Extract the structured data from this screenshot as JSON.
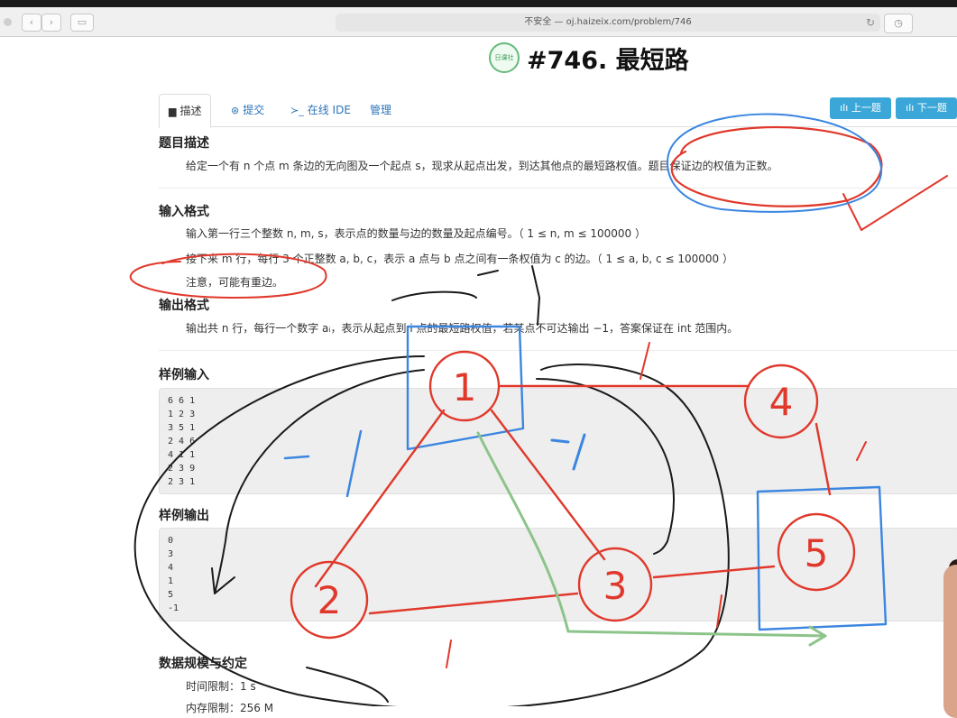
{
  "browser": {
    "url": "不安全 — oj.haizeix.com/problem/746",
    "back_icon": "‹",
    "forward_icon": "›",
    "sidebar_icon": "▭",
    "reload_icon": "↻",
    "history_icon": "◷"
  },
  "logo_text": "日课社",
  "problem_title": "#746. 最短路",
  "tabs": [
    {
      "label": "描述",
      "icon": "▆"
    },
    {
      "label": "提交",
      "icon": "⊛"
    },
    {
      "label": "在线 IDE",
      "icon": "≻_"
    },
    {
      "label": "管理",
      "icon": ""
    }
  ],
  "nav_buttons": {
    "prev": "上一题",
    "next": "下一题",
    "icon": "ılı"
  },
  "sections": {
    "description_title": "题目描述",
    "description_text": "给定一个有 n 个点 m 条边的无向图及一个起点 s，现求从起点出发，到达其他点的最短路权值。题目保证边的权值为正数。",
    "input_title": "输入格式",
    "input_lines": [
      "输入第一行三个整数 n, m, s，表示点的数量与边的数量及起点编号。（ 1 ≤ n, m ≤ 100000 ）",
      "接下来 m 行，每行 3 个正整数 a, b, c，表示 a 点与 b 点之间有一条权值为 c 的边。（ 1 ≤ a, b, c ≤ 100000 ）",
      "注意，可能有重边。"
    ],
    "output_title": "输出格式",
    "output_text": "输出共 n 行，每行一个数字 aᵢ，表示从起点到 i 点的最短路权值，若某点不可达输出 −1，答案保证在 int 范围内。",
    "sample_input_title": "样例输入",
    "sample_input": [
      "6 6 1",
      "1 2 3",
      "3 5 1",
      "2 4 6",
      "4 1 1",
      "2 3 9",
      "2 3 1"
    ],
    "sample_output_title": "样例输出",
    "sample_output": [
      "0",
      "3",
      "4",
      "1",
      "5",
      "-1"
    ],
    "limits_title": "数据规模与约定",
    "time_limit": "时间限制：1 s",
    "memory_limit": "内存限制：256 M"
  },
  "annotations": {
    "nodes": [
      "1",
      "2",
      "3",
      "4",
      "5"
    ],
    "colors": {
      "red": "#e0382b",
      "blue": "#3b86e0",
      "green": "#8cc48a",
      "black": "#1a1a1a"
    }
  }
}
